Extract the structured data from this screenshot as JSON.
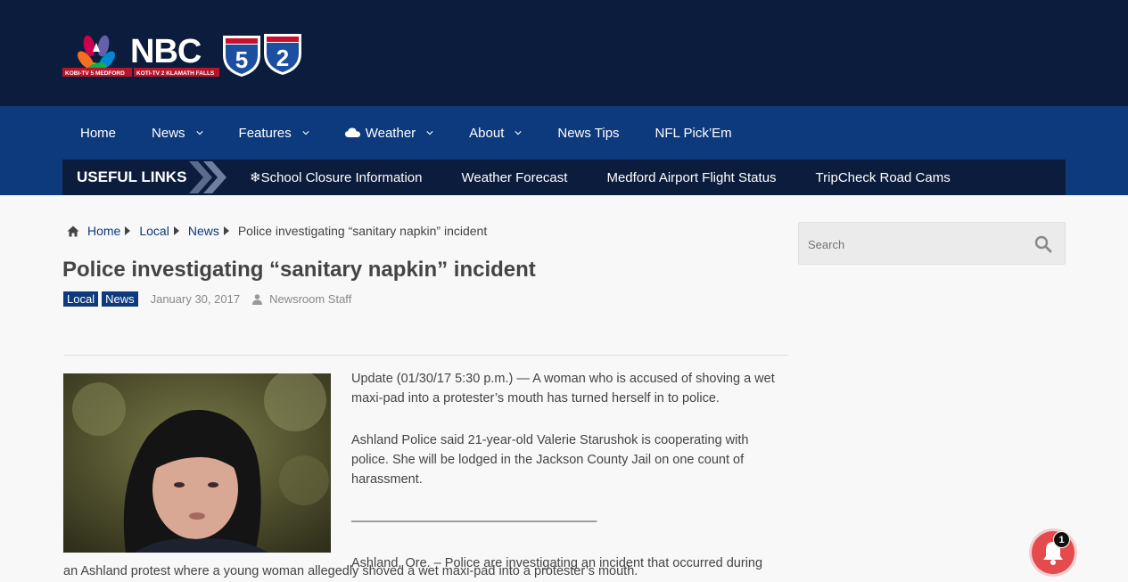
{
  "brand": {
    "logo_wordmark": "NBC",
    "logo_numbers": [
      "5",
      "2"
    ],
    "logo_subtext": [
      "KOBI-TV 5 MEDFORD",
      "KOTI-TV 2 KLAMATH FALLS"
    ]
  },
  "nav": {
    "items": [
      {
        "label": "Home",
        "has_dropdown": false
      },
      {
        "label": "News",
        "has_dropdown": true
      },
      {
        "label": "Features",
        "has_dropdown": true
      },
      {
        "label": "Weather",
        "has_dropdown": true,
        "icon": "cloud-icon"
      },
      {
        "label": "About",
        "has_dropdown": true
      },
      {
        "label": "News Tips",
        "has_dropdown": false
      },
      {
        "label": "NFL Pick’Em",
        "has_dropdown": false
      }
    ]
  },
  "useful_links": {
    "title": "USEFUL LINKS",
    "links": [
      "❄School Closure Information",
      "Weather Forecast",
      "Medford Airport Flight Status",
      "TripCheck Road Cams"
    ]
  },
  "breadcrumb": {
    "items": [
      "Home",
      "Local",
      "News"
    ],
    "current": "Police investigating “sanitary napkin” incident"
  },
  "post": {
    "title": "Police investigating “sanitary napkin” incident",
    "tags": [
      "Local",
      "News"
    ],
    "date": "January 30, 2017",
    "author": "Newsroom Staff",
    "paragraphs": [
      "Update (01/30/17 5:30 p.m.) — A woman who is accused of shoving a wet maxi-pad into a protester’s mouth has turned herself in to police.",
      "Ashland Police said 21-year-old Valerie Starushok is cooperating with police. She will be lodged in the Jackson County Jail on one count of harassment.",
      "———————————————————",
      "Ashland, Ore. – Police are investigating an incident that occurred during"
    ],
    "continuation": "an Ashland protest where a young woman allegedly shoved a wet maxi-pad into a protester’s mouth."
  },
  "sidebar": {
    "search_placeholder": "Search"
  },
  "notification": {
    "count": "1"
  },
  "colors": {
    "header_bg": "#0c1c3c",
    "nav_bg": "#0d3a7d",
    "accent": "#0d3a7d",
    "bell": "#e54b4d"
  }
}
